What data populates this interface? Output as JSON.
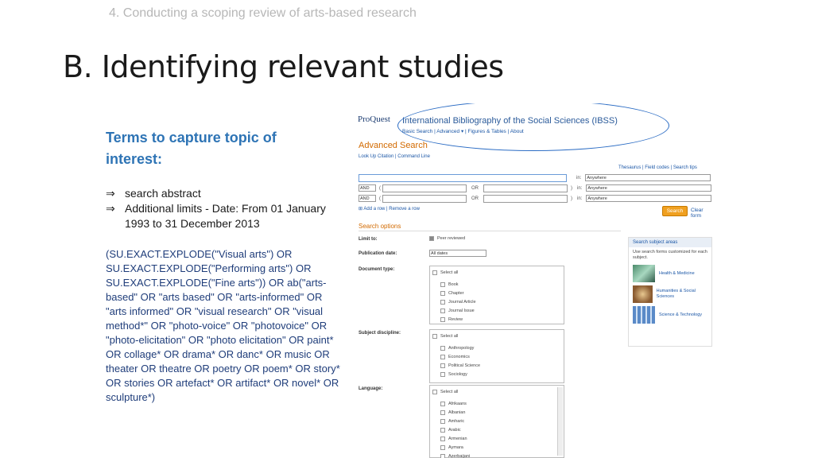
{
  "breadcrumb": "4. Conducting a scoping review of arts-based research",
  "title": "B. Identifying relevant studies",
  "terms_heading": "Terms to capture topic of interest:",
  "bullets": [
    "search abstract",
    "Additional limits - Date: From 01 January 1993 to 31 December 2013"
  ],
  "query": "(SU.EXACT.EXPLODE(\"Visual arts\") OR SU.EXACT.EXPLODE(\"Performing arts\") OR SU.EXACT.EXPLODE(\"Fine arts\")) OR ab(\"arts-based\" OR \"arts based\" OR \"arts-informed\" OR \"arts informed\" OR \"visual research\" OR \"visual method*\" OR \"photo-voice\" OR \"photovoice\" OR \"photo-elicitation\" OR \"photo elicitation\" OR paint* OR collage* OR drama* OR danc* OR music OR theater OR theatre OR poetry OR poem* OR story* OR stories OR artefact* OR artifact* OR novel* OR sculpture*)",
  "screenshot": {
    "logo": "ProQuest",
    "db_title": "International Bibliography of the Social Sciences (IBSS)",
    "topnav": "Basic Search  |  Advanced ▾  |  Figures & Tables  |  About",
    "advanced_search": "Advanced Search",
    "sublinks": "Look Up Citation  |  Command Line",
    "rightlinks": "Thesaurus  |  Field codes  |  Search tips",
    "in_label": "in:",
    "anywhere": "Anywhere",
    "and": "AND",
    "or": "OR",
    "add_row": "⊞ Add a row  |  Remove a row",
    "search_btn": "Search",
    "clear_form": "Clear form",
    "search_options": "Search options",
    "limit_to": "Limit to:",
    "peer_reviewed": "Peer reviewed",
    "publication_date": "Publication date:",
    "all_dates": "All dates",
    "document_type": "Document type:",
    "doc_items": [
      "Select all",
      "Book",
      "Chapter",
      "Journal Article",
      "Journal Issue",
      "Review"
    ],
    "subject_discipline": "Subject discipline:",
    "disc_items": [
      "Select all",
      "Anthropology",
      "Economics",
      "Political Science",
      "Sociology"
    ],
    "language": "Language:",
    "lang_items": [
      "Select all",
      "Afrikaans",
      "Albanian",
      "Amharic",
      "Arabic",
      "Armenian",
      "Aymara",
      "Azerbaijani"
    ],
    "subject_areas_head": "Search subject areas",
    "subject_areas_desc": "Use search forms customized for each subject.",
    "subject_health": "Health & Medicine",
    "subject_humanities": "Humanities & Social Sciences",
    "subject_science": "Science & Technology"
  }
}
